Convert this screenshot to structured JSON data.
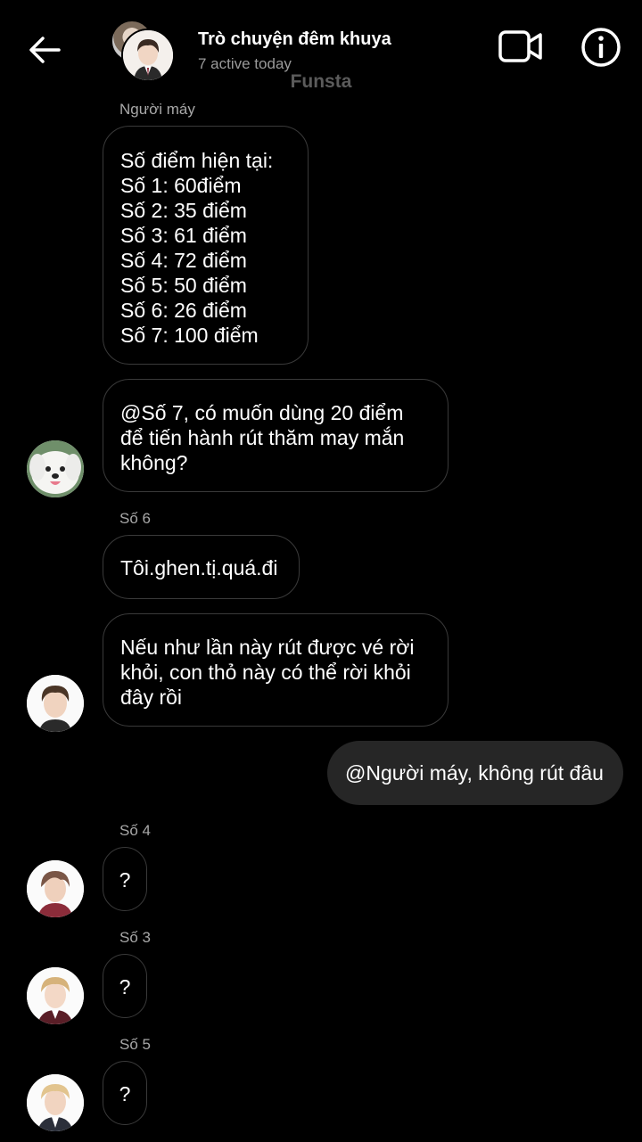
{
  "header": {
    "title": "Trò chuyện đêm khuya",
    "subtitle": "7 active today",
    "watermark": "Funsta",
    "icons": {
      "back": "arrow-left-icon",
      "video": "video-camera-icon",
      "info": "info-icon"
    }
  },
  "messages": [
    {
      "sender": "Người máy",
      "lines": [
        "Số điểm hiện tại:",
        "Số 1: 60điểm",
        "Số 2: 35 điểm",
        "Số 3: 61 điểm",
        "Số 4: 72 điểm",
        "Số 5: 50 điểm",
        "Số 6: 26 điểm",
        "Số 7: 100 điểm"
      ]
    },
    {
      "lines": [
        "@Số 7, có muốn dùng 20 điểm",
        "để tiến hành rút thăm may mắn",
        "không?"
      ]
    },
    {
      "sender": "Số 6",
      "lines": [
        "Tôi.ghen.tị.quá.đi"
      ]
    },
    {
      "lines": [
        "Nếu như lần này rút được vé rời",
        "khỏi, con thỏ này có thể rời khỏi",
        "đây rồi"
      ]
    },
    {
      "outgoing": true,
      "text": "@Người máy, không rút đâu"
    },
    {
      "sender": "Số 4",
      "lines": [
        "?"
      ]
    },
    {
      "sender": "Số 3",
      "lines": [
        "?"
      ]
    },
    {
      "sender": "Số 5",
      "lines": [
        "?"
      ]
    }
  ],
  "colors": {
    "background": "#000000",
    "incoming_border": "#3a3a3a",
    "outgoing_bubble": "#262626",
    "muted_text": "#a8a8a8"
  }
}
